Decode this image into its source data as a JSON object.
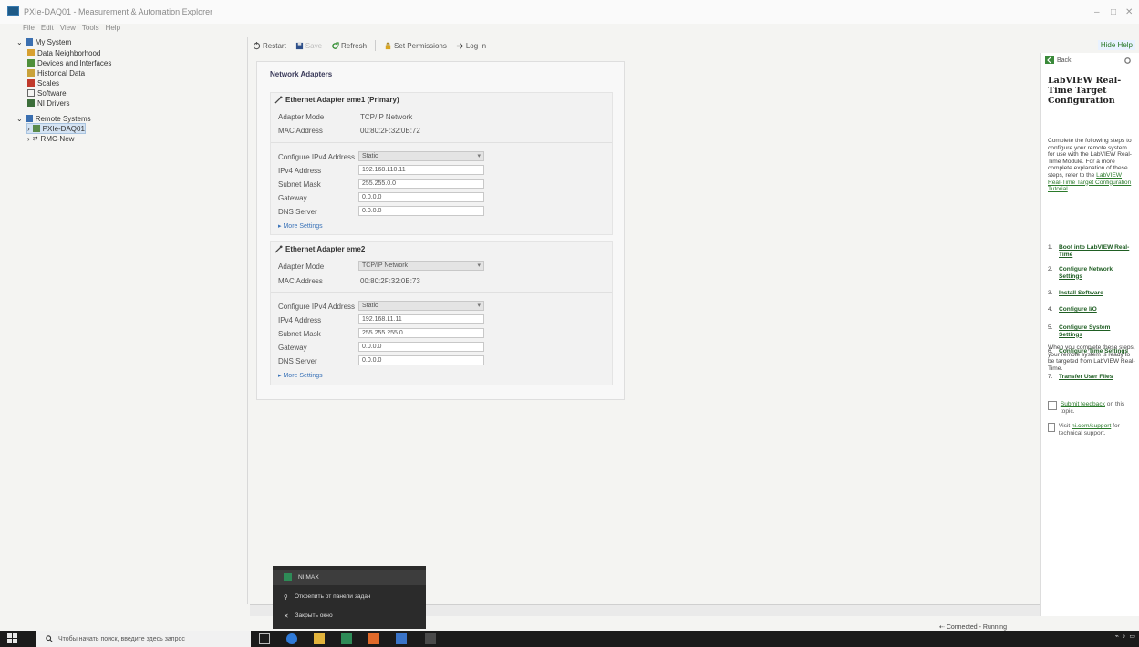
{
  "window": {
    "title": "PXIe-DAQ01 - Measurement & Automation Explorer",
    "controls": [
      "–",
      "□",
      "✕"
    ]
  },
  "menu": [
    "File",
    "Edit",
    "View",
    "Tools",
    "Help"
  ],
  "toolbar": {
    "restart": "Restart",
    "save": "Save",
    "refresh": "Refresh",
    "permissions": "Set Permissions",
    "login": "Log In",
    "hide_help": "Hide Help"
  },
  "tree": {
    "my_system": "My System",
    "data_neighborhood": "Data Neighborhood",
    "devices": "Devices and Interfaces",
    "historical": "Historical Data",
    "scales": "Scales",
    "software": "Software",
    "ni_drivers": "NI Drivers",
    "remote": "Remote Systems",
    "target": "PXIe-DAQ01",
    "rmc": "RMC-New"
  },
  "main": {
    "section_title": "Network Adapters",
    "adapters": [
      {
        "name": "Ethernet Adapter eme1 (Primary)",
        "mode_label": "Adapter Mode",
        "mode_value": "TCP/IP Network",
        "mac_label": "MAC Address",
        "mac_value": "00:80:2F:32:0B:72",
        "cfg_label": "Configure IPv4 Address",
        "cfg_value": "Static",
        "ip_label": "IPv4 Address",
        "ip_value": "192.168.110.11",
        "mask_label": "Subnet Mask",
        "mask_value": "255.255.0.0",
        "gw_label": "Gateway",
        "gw_value": "0.0.0.0",
        "dns_label": "DNS Server",
        "dns_value": "0.0.0.0",
        "more": "More Settings"
      },
      {
        "name": "Ethernet Adapter eme2",
        "mode_label": "Adapter Mode",
        "mode_value": "TCP/IP Network",
        "mac_label": "MAC Address",
        "mac_value": "00:80:2F:32:0B:73",
        "cfg_label": "Configure IPv4 Address",
        "cfg_value": "Static",
        "ip_label": "IPv4 Address",
        "ip_value": "192.168.11.11",
        "mask_label": "Subnet Mask",
        "mask_value": "255.255.255.0",
        "gw_label": "Gateway",
        "gw_value": "0.0.0.0",
        "dns_label": "DNS Server",
        "dns_value": "0.0.0.0",
        "more": "More Settings"
      }
    ]
  },
  "help": {
    "back": "Back",
    "title": "LabVIEW Real-Time Target Configuration",
    "intro": "Complete the following steps to configure your remote system for use with the LabVIEW Real-Time Module. For a more complete explanation of these steps, refer to the",
    "intro_link": "LabVIEW Real-Time Target Configuration Tutorial",
    "steps": [
      {
        "n": "1.",
        "t": "Boot into LabVIEW Real-Time"
      },
      {
        "n": "2.",
        "t": "Configure Network Settings"
      },
      {
        "n": "3.",
        "t": "Install Software"
      },
      {
        "n": "4.",
        "t": "Configure I/O"
      },
      {
        "n": "5.",
        "t": "Configure System Settings"
      },
      {
        "n": "6.",
        "t": "Configure Time Settings"
      },
      {
        "n": "7.",
        "t": "Transfer User Files"
      }
    ],
    "outro": "When you complete these steps, your remote system is ready to be targeted from LabVIEW Real-Time.",
    "feedback_link": "Submit feedback",
    "feedback_rest": "on this topic.",
    "visit": "Visit",
    "support_link": "ni.com/support",
    "support_rest": "for technical support."
  },
  "status": "Connected - Running",
  "jumplist": {
    "app": "NI MAX",
    "unpin": "Открепить от панели задач",
    "close": "Закрыть окно"
  },
  "taskbar": {
    "search_placeholder": "Чтобы начать поиск, введите здесь запрос"
  }
}
